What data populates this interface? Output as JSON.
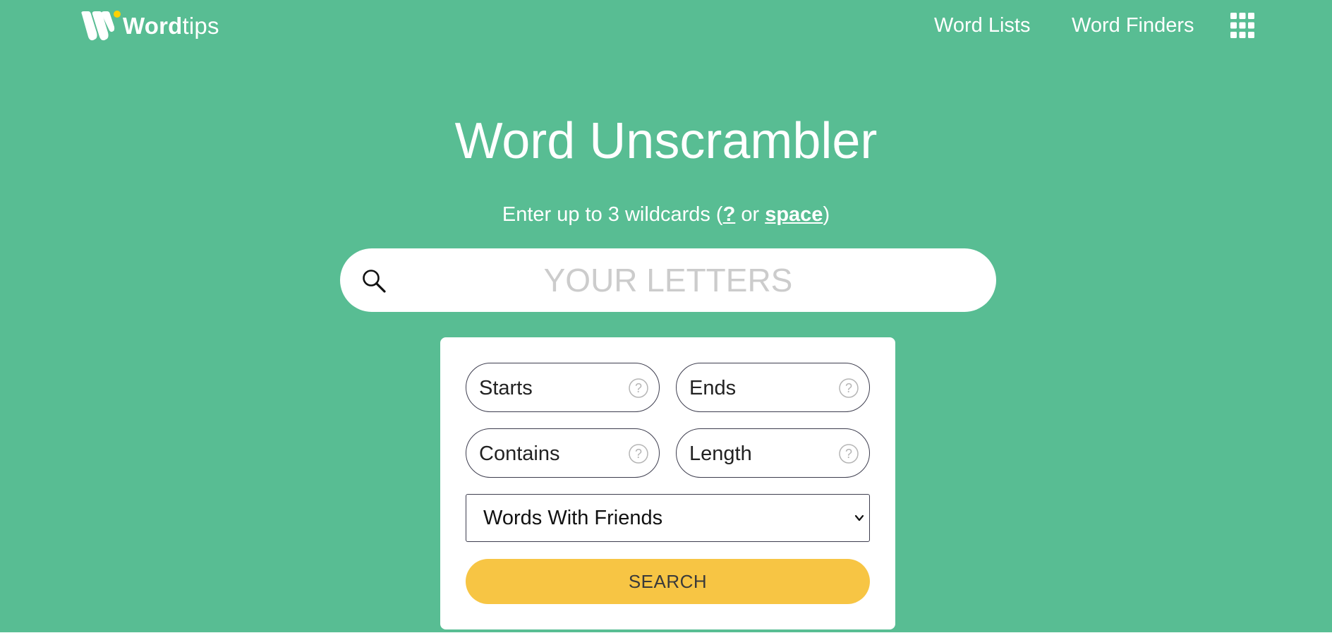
{
  "header": {
    "logo": {
      "brand_bold": "Word",
      "brand_light": "tips"
    },
    "nav": {
      "word_lists": "Word Lists",
      "word_finders": "Word Finders",
      "menu_icon": "grid-icon"
    }
  },
  "main": {
    "title": "Word Unscrambler",
    "subtitle": {
      "prefix": "Enter up to 3 wildcards (",
      "wildcard_symbol": "?",
      "separator": " or ",
      "wildcard_space": "space",
      "suffix": ")"
    },
    "search": {
      "placeholder": "YOUR LETTERS",
      "value": "",
      "icon": "search-icon"
    }
  },
  "filters": {
    "starts": {
      "placeholder": "Starts",
      "value": ""
    },
    "ends": {
      "placeholder": "Ends",
      "value": ""
    },
    "contains": {
      "placeholder": "Contains",
      "value": ""
    },
    "length": {
      "placeholder": "Length",
      "value": ""
    },
    "help_icon": "question-circle-icon",
    "dictionary": {
      "selected": "Words With Friends",
      "icon": "chevron-down-icon"
    },
    "search_button": "SEARCH"
  },
  "colors": {
    "background": "#58bd93",
    "accent_yellow": "#f7c544",
    "logo_dot": "#ffd200",
    "input_border": "#3d3d4e",
    "placeholder_gray": "#cccccc",
    "white": "#ffffff"
  }
}
